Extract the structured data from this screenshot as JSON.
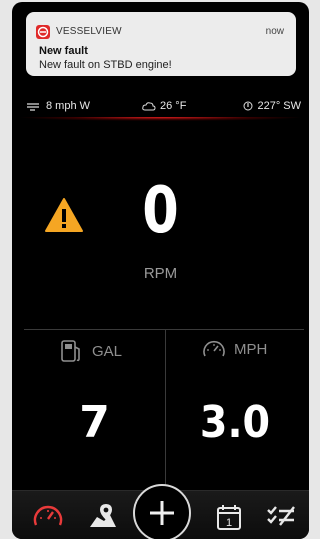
{
  "notification": {
    "app_name": "VESSELVIEW",
    "time": "now",
    "title": "New fault",
    "body": "New fault on STBD engine!"
  },
  "status_bar": {
    "wind": "8 mph W",
    "temperature": "26 °F",
    "heading": "227° SW"
  },
  "gauges": {
    "rpm_value": "0",
    "rpm_label": "RPM",
    "gal_label": "GAL",
    "gal_value": "7",
    "mph_label": "MPH",
    "mph_value": "3.0"
  },
  "nav": {
    "items": [
      "gauges-icon",
      "map-pin-icon",
      "add-icon",
      "calendar-icon",
      "checklist-icon"
    ],
    "calendar_day": "1",
    "active_color": "#e83a3a"
  },
  "colors": {
    "warning": "#f5a623",
    "accent_red": "#e02a2a"
  }
}
